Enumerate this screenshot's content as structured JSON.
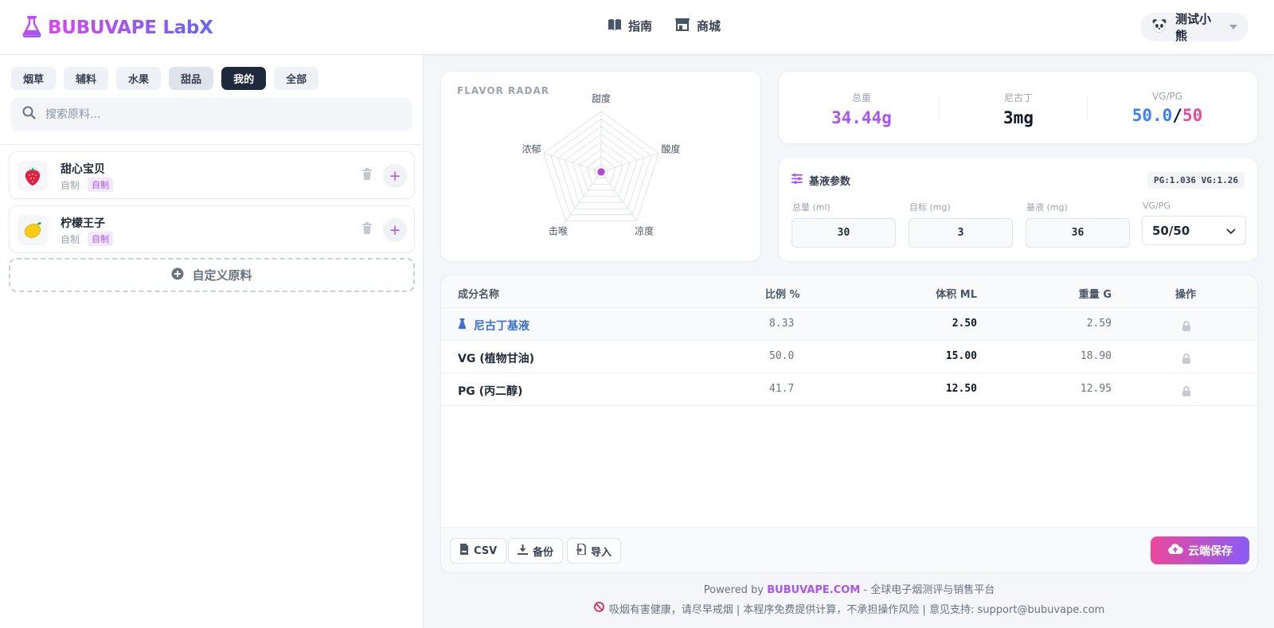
{
  "app": {
    "title": "BUBUVAPE LabX"
  },
  "nav": [
    {
      "label": "指南",
      "icon": "book-icon"
    },
    {
      "label": "商城",
      "icon": "store-icon"
    }
  ],
  "user": {
    "name": "测试小熊",
    "avatar": "panda-icon"
  },
  "sidebar": {
    "tabs": [
      "烟草",
      "辅料",
      "水果",
      "甜品",
      "我的",
      "全部"
    ],
    "active_tab": "我的",
    "search_placeholder": "搜索原料...",
    "items": [
      {
        "name": "甜心宝贝",
        "source": "自制",
        "badge": "自制",
        "icon": "strawberry-icon"
      },
      {
        "name": "柠檬王子",
        "source": "自制",
        "badge": "自制",
        "icon": "lemon-icon"
      }
    ],
    "custom_button": "自定义原料"
  },
  "radar": {
    "title": "FLAVOR RADAR",
    "axes": [
      "甜度",
      "酸度",
      "凉度",
      "击喉",
      "浓郁"
    ],
    "values": [
      0,
      0,
      0,
      0,
      0
    ]
  },
  "stats": {
    "total_weight_label": "总重",
    "total_weight": "34.44g",
    "nicotine_label": "尼古丁",
    "nicotine": "3mg",
    "ratio_label": "VG/PG",
    "vg": "50.0",
    "slash": "/",
    "pg": "50"
  },
  "params": {
    "title": "基液参数",
    "density": "PG:1.036 VG:1.26",
    "fields": [
      {
        "label": "总量 (ml)",
        "value": "30"
      },
      {
        "label": "目标 (mg)",
        "value": "3"
      },
      {
        "label": "基液 (mg)",
        "value": "36"
      }
    ],
    "ratio_label": "VG/PG",
    "ratio_value": "50/50"
  },
  "table": {
    "headers": {
      "name": "成分名称",
      "ratio": "比例 %",
      "volume": "体积 ML",
      "weight": "重量 G",
      "action": "操作"
    },
    "rows": [
      {
        "name": "尼古丁基液",
        "ratio": "8.33",
        "volume": "2.50",
        "weight": "2.59"
      },
      {
        "name": "VG (植物甘油)",
        "ratio": "50.0",
        "volume": "15.00",
        "weight": "18.90"
      },
      {
        "name": "PG (丙二醇)",
        "ratio": "41.7",
        "volume": "12.50",
        "weight": "12.95"
      }
    ],
    "buttons": {
      "csv": "CSV",
      "backup": "备份",
      "import": "导入",
      "save": "云端保存"
    }
  },
  "footer": {
    "powered": "Powered by",
    "brand": "BUBUVAPE.COM",
    "tagline": " - 全球电子烟测评与销售平台",
    "notice": "吸烟有害健康，请尽早戒烟 | 本程序免费提供计算，不承担操作风险 | 意见支持: support@bubuvape.com"
  },
  "colors": {
    "accent": "#a855f7",
    "brand_gradient_start": "#d946ef",
    "brand_gradient_end": "#6366f1",
    "vg": "#3b82f6",
    "pg": "#ec4899",
    "dark_tab": "#1e293b"
  }
}
